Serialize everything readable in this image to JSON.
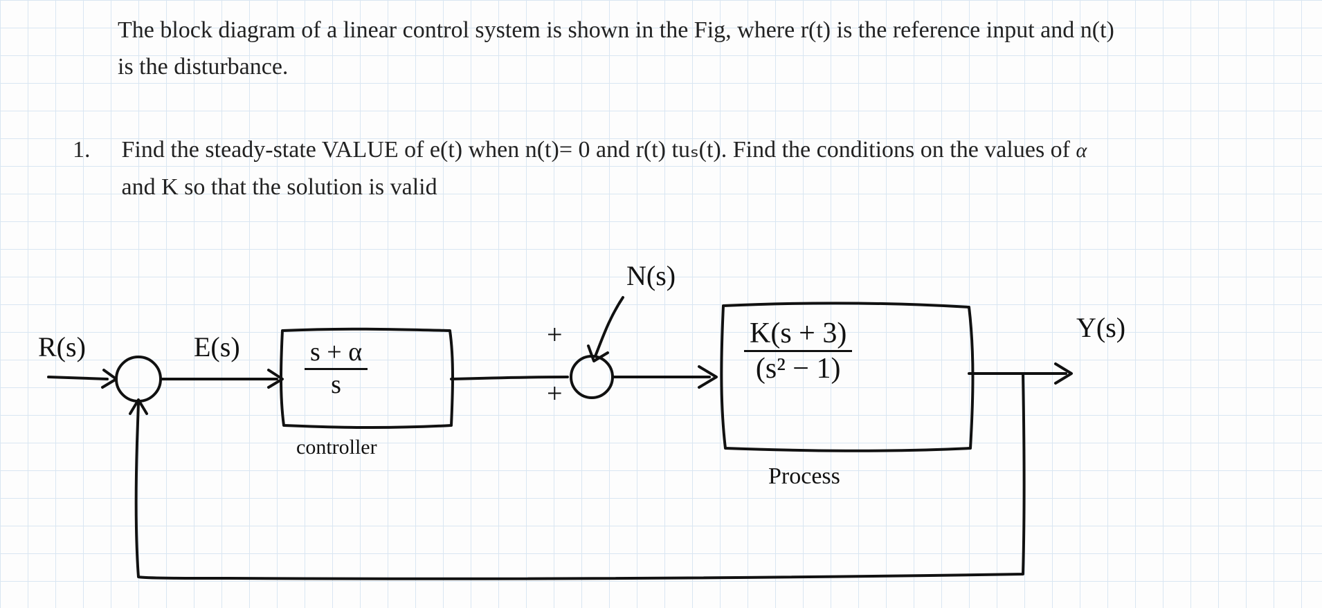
{
  "intro": "The block diagram of a linear control system is shown in the Fig, where r(t) is the reference input and n(t) is the disturbance.",
  "question": {
    "number": "1.",
    "text_before_alpha": "Find the steady-state VALUE of e(t) when n(t)= 0 and r(t) tuₛ(t). Find the conditions on the values of",
    "alpha": "α",
    "text_after_alpha": "and K so that the solution is valid"
  },
  "signals": {
    "R": "R(s)",
    "E": "E(s)",
    "N": "N(s)",
    "Y": "Y(s)",
    "plus1": "+",
    "plus2": "+"
  },
  "controller": {
    "tf_num": "s + α",
    "tf_den": "s",
    "label": "controller"
  },
  "process": {
    "tf_num": "K(s + 3)",
    "tf_den": "(s² − 1)",
    "label": "Process"
  }
}
